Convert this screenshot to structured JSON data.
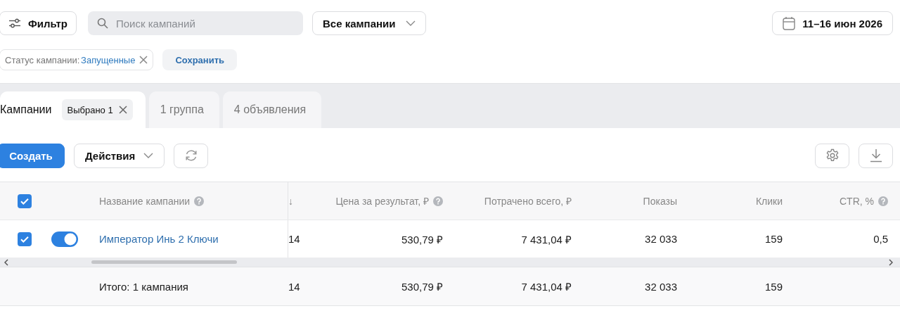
{
  "toolbar": {
    "filter_button": "Фильтр",
    "search": {
      "placeholder": "Поиск кампаний"
    },
    "campaigns_dropdown": "Все кампании",
    "date_button": "11–16 июн 2026"
  },
  "filters": {
    "chips": [
      {
        "label": "Статус кампании:",
        "value": "Запущенные"
      }
    ],
    "save_button": "Сохранить"
  },
  "tabs": [
    {
      "label": "Кампании",
      "selected": true,
      "badge": "Выбрано 1"
    },
    {
      "label": "1 группа",
      "selected": false
    },
    {
      "label": "4 объявления",
      "selected": false
    }
  ],
  "actions": {
    "create_button": "Создать",
    "actions_dropdown": "Действия"
  },
  "table": {
    "select_all_checked": true,
    "columns": [
      {
        "label": "Название кампании",
        "help": true
      },
      {
        "label": "↓",
        "help": false
      },
      {
        "label": "Цена за результат, ₽",
        "help": true
      },
      {
        "label": "Потрачено всего, ₽",
        "help": false
      },
      {
        "label": "Показы",
        "help": false
      },
      {
        "label": "Клики",
        "help": false
      },
      {
        "label": "CTR, %",
        "help": true
      }
    ],
    "rows": [
      {
        "checked": true,
        "on": true,
        "cells": [
          "Император Инь 2 Ключи",
          "14",
          "530,79 ₽",
          "7 431,04 ₽",
          "32 033",
          "159",
          "0,5"
        ]
      }
    ],
    "total": {
      "cells": [
        "Итого: 1 кампания",
        "14",
        "530,79 ₽",
        "7 431,04 ₽",
        "32 033",
        "159"
      ]
    }
  }
}
